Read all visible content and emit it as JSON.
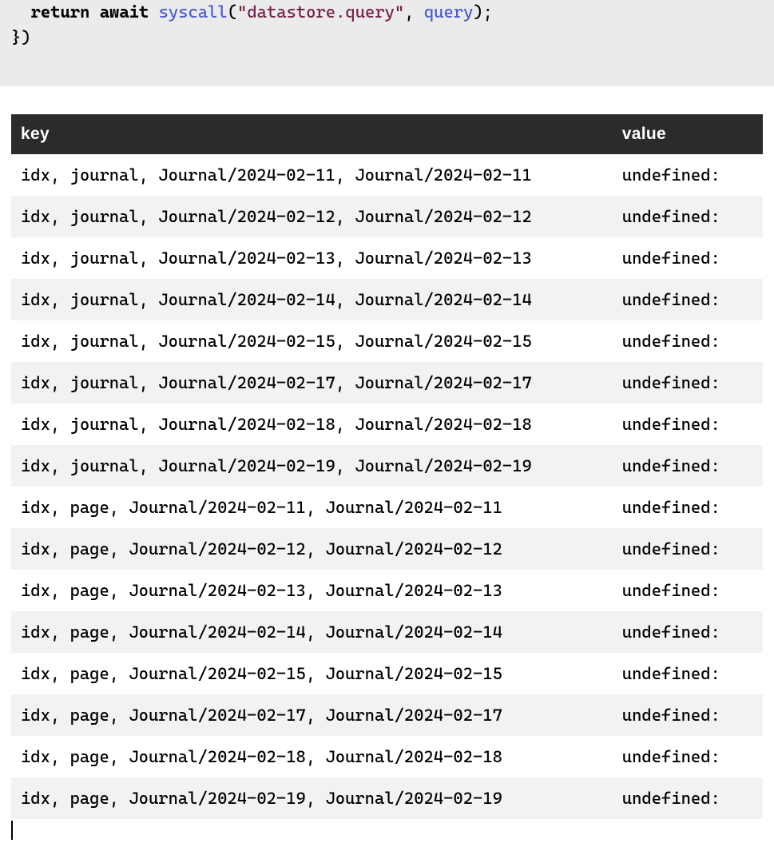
{
  "code": {
    "indent": "  ",
    "kw_return": "return",
    "kw_await": "await",
    "fn": "syscall",
    "paren_open": "(",
    "str": "\"datastore.query\"",
    "comma": ", ",
    "arg": "query",
    "paren_close": ");",
    "line2": "})"
  },
  "table": {
    "headers": {
      "key": "key",
      "value": "value"
    },
    "rows": [
      {
        "key": "idx, journal, Journal/2024-02-11, Journal/2024-02-11",
        "value": "undefined:"
      },
      {
        "key": "idx, journal, Journal/2024-02-12, Journal/2024-02-12",
        "value": "undefined:"
      },
      {
        "key": "idx, journal, Journal/2024-02-13, Journal/2024-02-13",
        "value": "undefined:"
      },
      {
        "key": "idx, journal, Journal/2024-02-14, Journal/2024-02-14",
        "value": "undefined:"
      },
      {
        "key": "idx, journal, Journal/2024-02-15, Journal/2024-02-15",
        "value": "undefined:"
      },
      {
        "key": "idx, journal, Journal/2024-02-17, Journal/2024-02-17",
        "value": "undefined:"
      },
      {
        "key": "idx, journal, Journal/2024-02-18, Journal/2024-02-18",
        "value": "undefined:"
      },
      {
        "key": "idx, journal, Journal/2024-02-19, Journal/2024-02-19",
        "value": "undefined:"
      },
      {
        "key": "idx, page, Journal/2024-02-11, Journal/2024-02-11",
        "value": "undefined:"
      },
      {
        "key": "idx, page, Journal/2024-02-12, Journal/2024-02-12",
        "value": "undefined:"
      },
      {
        "key": "idx, page, Journal/2024-02-13, Journal/2024-02-13",
        "value": "undefined:"
      },
      {
        "key": "idx, page, Journal/2024-02-14, Journal/2024-02-14",
        "value": "undefined:"
      },
      {
        "key": "idx, page, Journal/2024-02-15, Journal/2024-02-15",
        "value": "undefined:"
      },
      {
        "key": "idx, page, Journal/2024-02-17, Journal/2024-02-17",
        "value": "undefined:"
      },
      {
        "key": "idx, page, Journal/2024-02-18, Journal/2024-02-18",
        "value": "undefined:"
      },
      {
        "key": "idx, page, Journal/2024-02-19, Journal/2024-02-19",
        "value": "undefined:"
      }
    ]
  }
}
